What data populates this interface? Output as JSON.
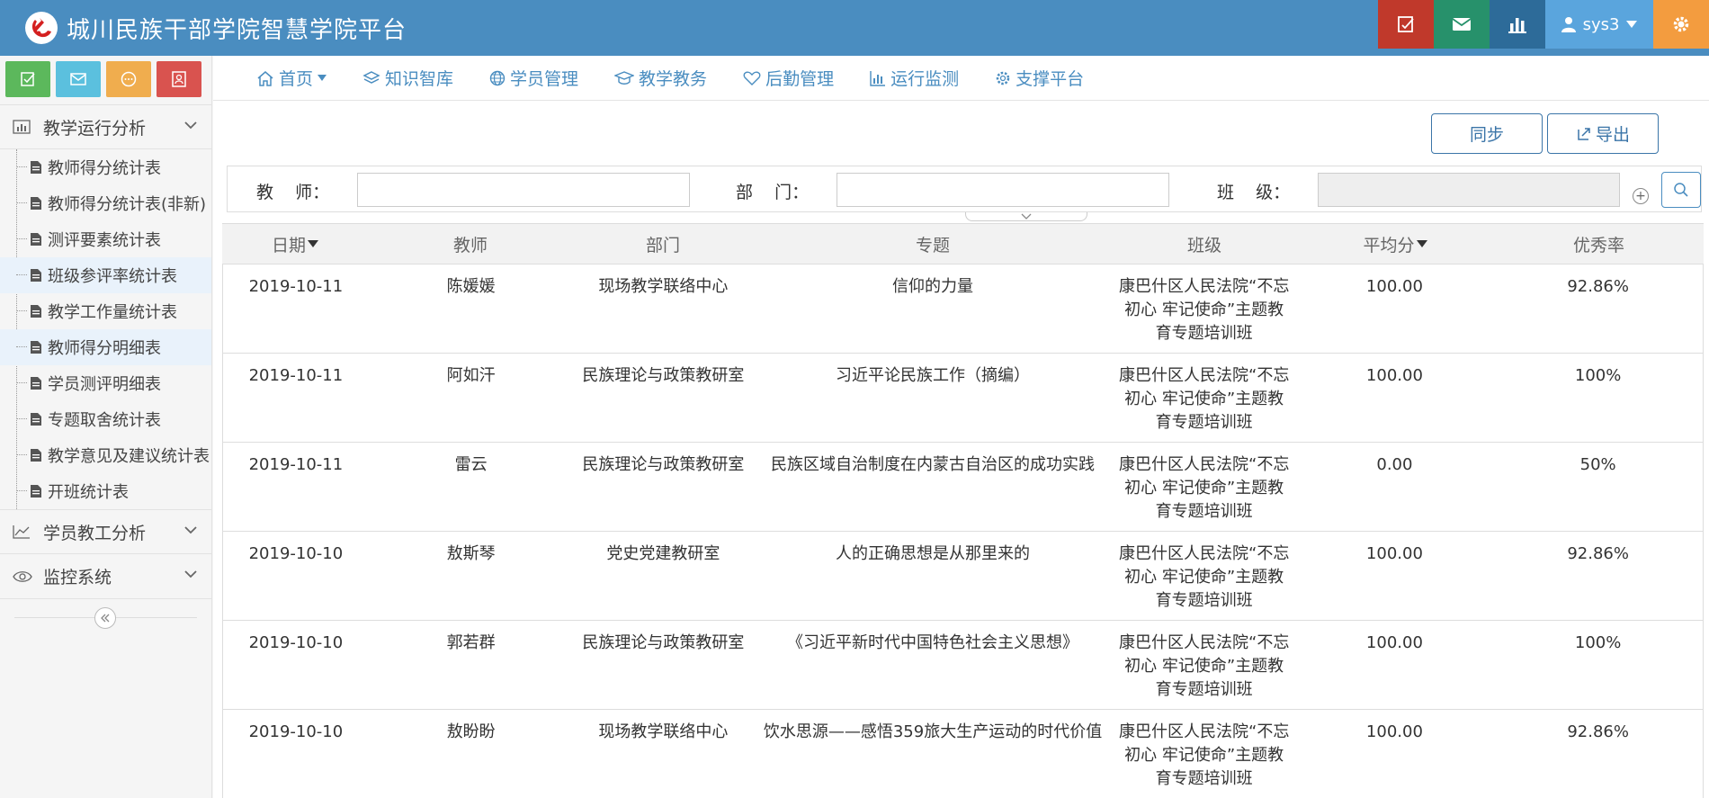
{
  "header": {
    "title": "城川民族干部学院智慧学院平台",
    "user": "sys3",
    "colors": {
      "bar": "#4a8dc0",
      "red": "#c0392b",
      "green": "#27916b",
      "navy": "#2d6b99",
      "user": "#5aa5dd",
      "orange": "#f39c3f"
    }
  },
  "sidebar": {
    "sections": [
      {
        "label": "教学运行分析",
        "icon": "bar-chart-icon"
      },
      {
        "label": "学员教工分析",
        "icon": "line-chart-icon"
      },
      {
        "label": "监控系统",
        "icon": "eye-icon"
      }
    ],
    "items": [
      {
        "label": "教师得分统计表"
      },
      {
        "label": "教师得分统计表(非新)"
      },
      {
        "label": "测评要素统计表"
      },
      {
        "label": "班级参评率统计表"
      },
      {
        "label": "教学工作量统计表"
      },
      {
        "label": "教师得分明细表"
      },
      {
        "label": "学员测评明细表"
      },
      {
        "label": "专题取舍统计表"
      },
      {
        "label": "教学意见及建议统计表"
      },
      {
        "label": "开班统计表"
      }
    ]
  },
  "nav": [
    {
      "label": "首页",
      "icon": "home-icon"
    },
    {
      "label": "知识智库",
      "icon": "layers-icon"
    },
    {
      "label": "学员管理",
      "icon": "globe-icon"
    },
    {
      "label": "教学教务",
      "icon": "graduation-cap-icon"
    },
    {
      "label": "后勤管理",
      "icon": "heart-icon"
    },
    {
      "label": "运行监测",
      "icon": "bar-chart-icon"
    },
    {
      "label": "支撑平台",
      "icon": "gear-icon"
    }
  ],
  "actions": {
    "sync": "同步",
    "export": "导出"
  },
  "filters": {
    "teacher_label": "教    师：",
    "dept_label": "部    门：",
    "class_label": "班    级："
  },
  "table": {
    "columns": [
      "日期",
      "教师",
      "部门",
      "专题",
      "班级",
      "平均分",
      "优秀率"
    ],
    "rows": [
      [
        "2019-10-11",
        "陈媛媛",
        "现场教学联络中心",
        "信仰的力量",
        "康巴什区人民法院“不忘初心 牢记使命”主题教育专题培训班",
        "100.00",
        "92.86%"
      ],
      [
        "2019-10-11",
        "阿如汗",
        "民族理论与政策教研室",
        "习近平论民族工作（摘编）",
        "康巴什区人民法院“不忘初心 牢记使命”主题教育专题培训班",
        "100.00",
        "100%"
      ],
      [
        "2019-10-11",
        "雷云",
        "民族理论与政策教研室",
        "民族区域自治制度在内蒙古自治区的成功实践",
        "康巴什区人民法院“不忘初心 牢记使命”主题教育专题培训班",
        "0.00",
        "50%"
      ],
      [
        "2019-10-10",
        "敖斯琴",
        "党史党建教研室",
        "人的正确思想是从那里来的",
        "康巴什区人民法院“不忘初心 牢记使命”主题教育专题培训班",
        "100.00",
        "92.86%"
      ],
      [
        "2019-10-10",
        "郭若群",
        "民族理论与政策教研室",
        "《习近平新时代中国特色社会主义思想》",
        "康巴什区人民法院“不忘初心 牢记使命”主题教育专题培训班",
        "100.00",
        "100%"
      ],
      [
        "2019-10-10",
        "敖盼盼",
        "现场教学联络中心",
        "饮水思源——感悟359旅大生产运动的时代价值",
        "康巴什区人民法院“不忘初心 牢记使命”主题教育专题培训班",
        "100.00",
        "92.86%"
      ]
    ]
  }
}
